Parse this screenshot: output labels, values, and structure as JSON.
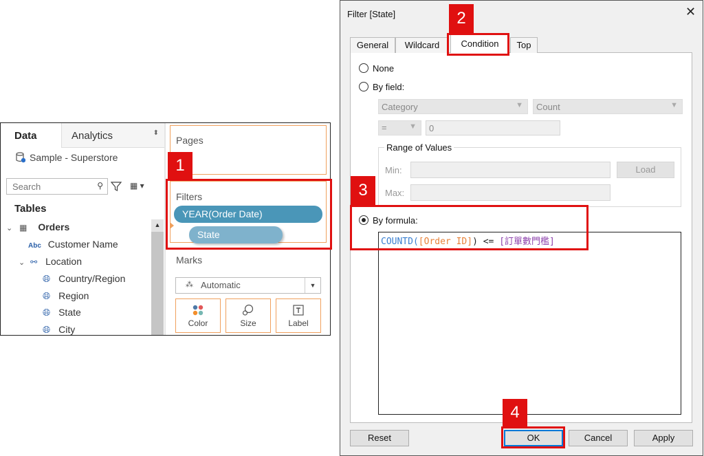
{
  "tableau": {
    "tabs": {
      "data": "Data",
      "analytics": "Analytics"
    },
    "datasource": "Sample - Superstore",
    "search_placeholder": "Search",
    "tables_heading": "Tables",
    "tree": [
      {
        "label": "Orders",
        "icon": "table-icon",
        "expand": "⌄",
        "bold": true
      },
      {
        "label": "Customer Name",
        "icon_text": "Abc"
      },
      {
        "label": "Location",
        "icon": "hierarchy-icon",
        "expand": "⌄"
      },
      {
        "label": "Country/Region",
        "icon": "globe-icon"
      },
      {
        "label": "Region",
        "icon": "globe-icon"
      },
      {
        "label": "State",
        "icon": "globe-icon"
      },
      {
        "label": "City",
        "icon": "globe-icon"
      }
    ],
    "shelves": {
      "pages": "Pages",
      "filters": "Filters",
      "filter_pills": [
        "YEAR(Order Date)",
        "State"
      ],
      "marks": "Marks",
      "mark_type": "Automatic",
      "mark_buttons": [
        "Color",
        "Size",
        "Label"
      ]
    }
  },
  "dialog": {
    "title": "Filter [State]",
    "close": "✕",
    "tabs": [
      "General",
      "Wildcard",
      "Condition",
      "Top"
    ],
    "active_tab": "Condition",
    "options": {
      "none": "None",
      "by_field": "By field:",
      "by_formula": "By formula:"
    },
    "selected_option": "by_formula",
    "field": "Category",
    "aggregation": "Count",
    "operator": "=",
    "value": "0",
    "range": {
      "label": "Range of Values",
      "min_label": "Min:",
      "max_label": "Max:",
      "load": "Load"
    },
    "formula": {
      "func": "COUNTD(",
      "field": "[Order ID]",
      "mid": ") <= ",
      "param": "[訂單數門檻]"
    },
    "buttons": {
      "reset": "Reset",
      "ok": "OK",
      "cancel": "Cancel",
      "apply": "Apply"
    }
  },
  "annotations": [
    "1",
    "2",
    "3",
    "4"
  ],
  "colors": {
    "annotation_red": "#e01010",
    "pill_blue": "#4a96b8",
    "pill_teal": "#7fb2cc",
    "shelf_orange": "#f0a05c",
    "formula_func": "#3a7fd0",
    "formula_field": "#e8823a",
    "formula_param": "#8e44ad"
  }
}
